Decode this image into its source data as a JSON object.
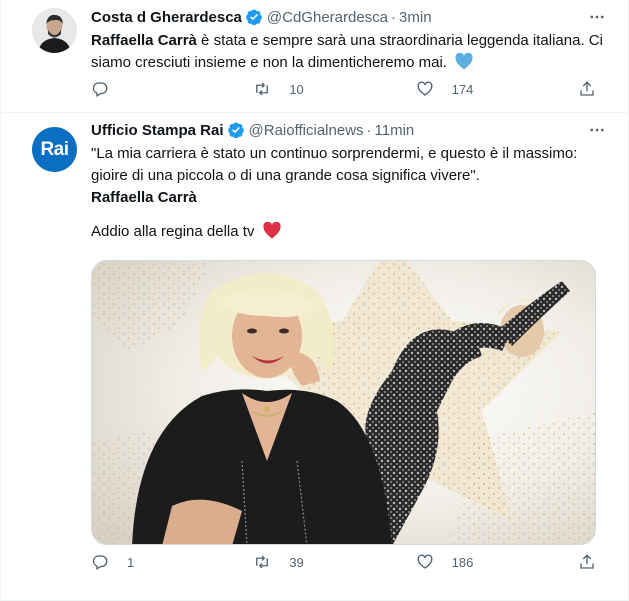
{
  "tweets": [
    {
      "author_name": "Costa d Gherardesca",
      "handle": "@CdGherardesca",
      "time": "3min",
      "text_bold": "Raffaella Carrà",
      "text_rest_1": " è stata e sempre sarà una straordinaria leggenda italiana. Ci",
      "text_line_2": "siamo cresciuti insieme e non la dimenticheremo mai.",
      "reply_count": "",
      "retweet_count": "10",
      "like_count": "174"
    },
    {
      "author_name": "Ufficio Stampa Rai",
      "handle": "@Raiofficialnews",
      "time": "11min",
      "avatar_text": "Rai",
      "quote_line_1": "\"La mia carriera è stato un continuo sorprendermi, e questo è il massimo:",
      "quote_line_2": "gioire di una piccola o di una grande cosa significa vivere\".",
      "quote_author": "Raffaella Carrà",
      "farewell": "Addio alla regina della tv",
      "reply_count": "1",
      "retweet_count": "39",
      "like_count": "186"
    }
  ],
  "icons": {
    "verified": "verified-badge-icon",
    "more": "more-dots-icon",
    "reply": "reply-icon",
    "retweet": "retweet-icon",
    "like": "heart-icon",
    "share": "share-icon",
    "blue_heart": "blue-heart-emoji",
    "red_heart": "red-heart-emoji"
  },
  "colors": {
    "verified": "#1d9bf0",
    "secondary_text": "#536471",
    "rai_blue": "#0a6fc2",
    "blue_heart": "#5dade2",
    "red_heart": "#dd2e44"
  }
}
